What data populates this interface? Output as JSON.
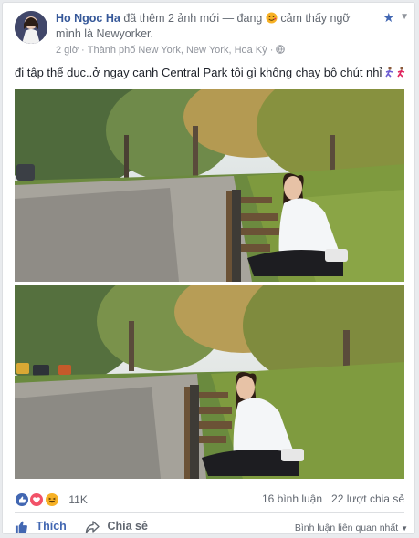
{
  "post": {
    "author": "Ho Ngoc Ha",
    "action_text": "đã thêm 2 ảnh mới — đang",
    "feeling_emoji": "smiling-face-icon",
    "feeling_text": "cảm thấy ngỡ mình là Newyorker.",
    "time": "2 giờ",
    "location": "Thành phố New York, New York, Hoa Kỳ",
    "privacy_icon": "globe-icon",
    "message": "đi tập thể dục..ở ngay cạnh Central Park tôi gì không chạy bộ chút nhỉ",
    "message_emoji": "runner-icon"
  },
  "reactions": {
    "icons": [
      "like-icon",
      "love-icon",
      "haha-icon"
    ],
    "count": "11K",
    "comments": "16 bình luận",
    "shares": "22 lượt chia sẻ"
  },
  "actions": {
    "like": "Thích",
    "share": "Chia sẻ",
    "related": "Bình luận liên quan nhất"
  },
  "colors": {
    "link": "#365899",
    "action_blue": "#4267b2",
    "muted": "#90949c",
    "background": "#e9ebee"
  }
}
